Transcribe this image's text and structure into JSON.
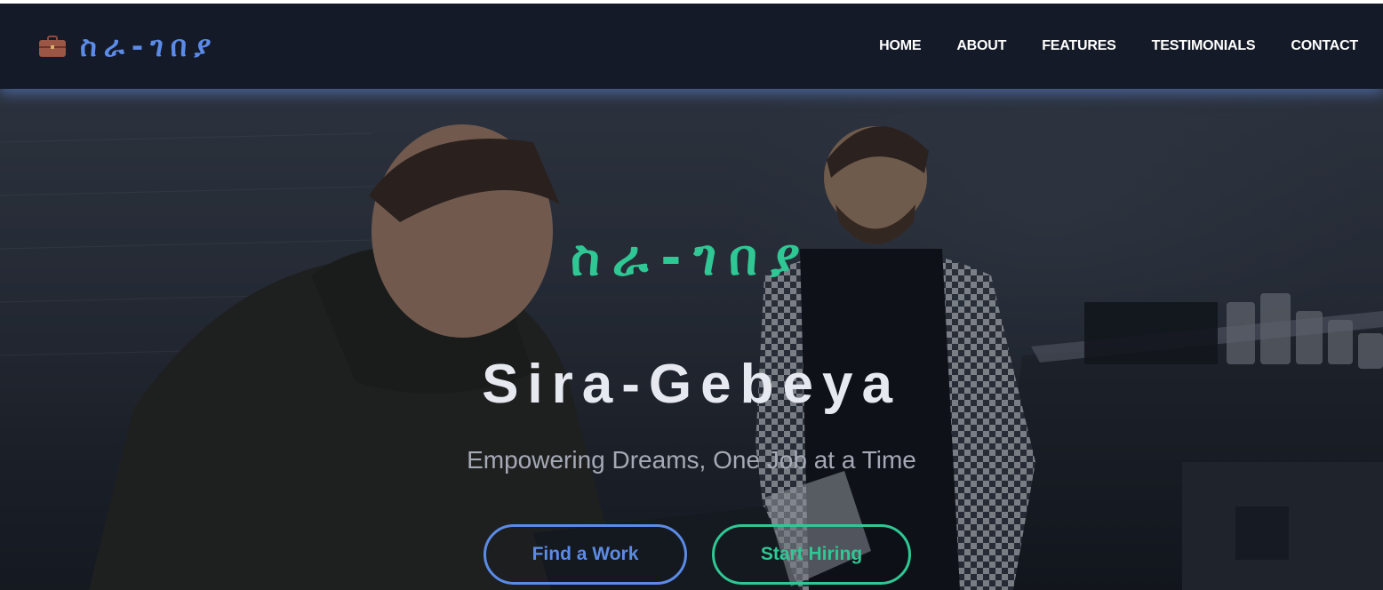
{
  "brand": {
    "icon": "briefcase-icon",
    "name": "ስራ-ገበያ",
    "color": "#5b8be6"
  },
  "nav": {
    "items": [
      {
        "label": "HOME"
      },
      {
        "label": "ABOUT"
      },
      {
        "label": "FEATURES"
      },
      {
        "label": "TESTIMONIALS"
      },
      {
        "label": "CONTACT"
      }
    ]
  },
  "hero": {
    "title_amharic": "ስራ-ገበያ",
    "title": "Sira-Gebeya",
    "tagline": "Empowering Dreams, One Job at a Time",
    "primary_button": "Find a Work",
    "secondary_button": "Start Hiring",
    "background_image": "two men at a coffee shop counter, one in a checkered shirt and apron",
    "colors": {
      "accent_green": "#2fc793",
      "accent_blue": "#5b8be6",
      "navbar": "#141a28"
    }
  }
}
